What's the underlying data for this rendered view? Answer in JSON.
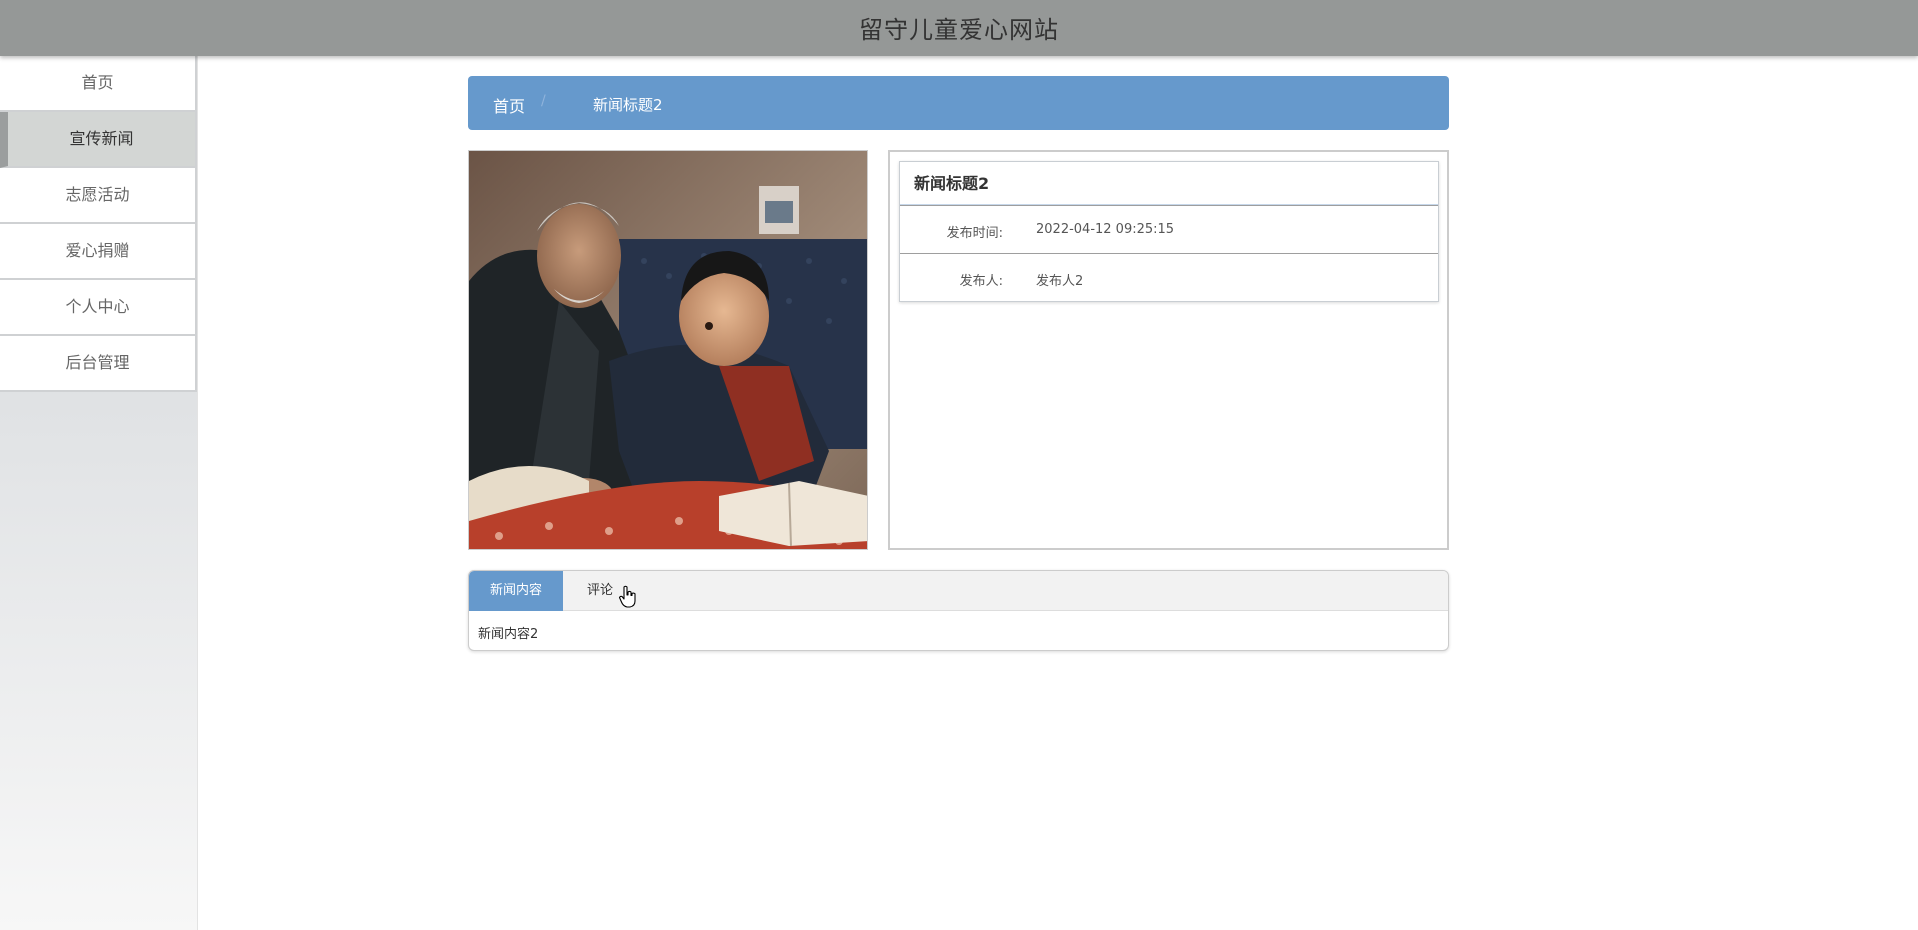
{
  "site": {
    "title": "留守儿童爱心网站"
  },
  "sidebar": {
    "items": [
      {
        "label": "首页",
        "active": false
      },
      {
        "label": "宣传新闻",
        "active": true
      },
      {
        "label": "志愿活动",
        "active": false
      },
      {
        "label": "爱心捐赠",
        "active": false
      },
      {
        "label": "个人中心",
        "active": false
      },
      {
        "label": "后台管理",
        "active": false
      }
    ]
  },
  "breadcrumb": {
    "home": "首页",
    "separator": "/",
    "current": "新闻标题2"
  },
  "news": {
    "title": "新闻标题2",
    "publish_time_label": "发布时间:",
    "publish_time": "2022-04-12 09:25:15",
    "publisher_label": "发布人:",
    "publisher": "发布人2"
  },
  "tabs": {
    "items": [
      "新闻内容",
      "评论"
    ],
    "active_index": 0,
    "content": "新闻内容2"
  },
  "colors": {
    "header": "#959897",
    "accent": "#6699cc",
    "sidebar_active": "#d3d6d4"
  },
  "icons": {
    "cursor": "hand-pointer-icon"
  }
}
